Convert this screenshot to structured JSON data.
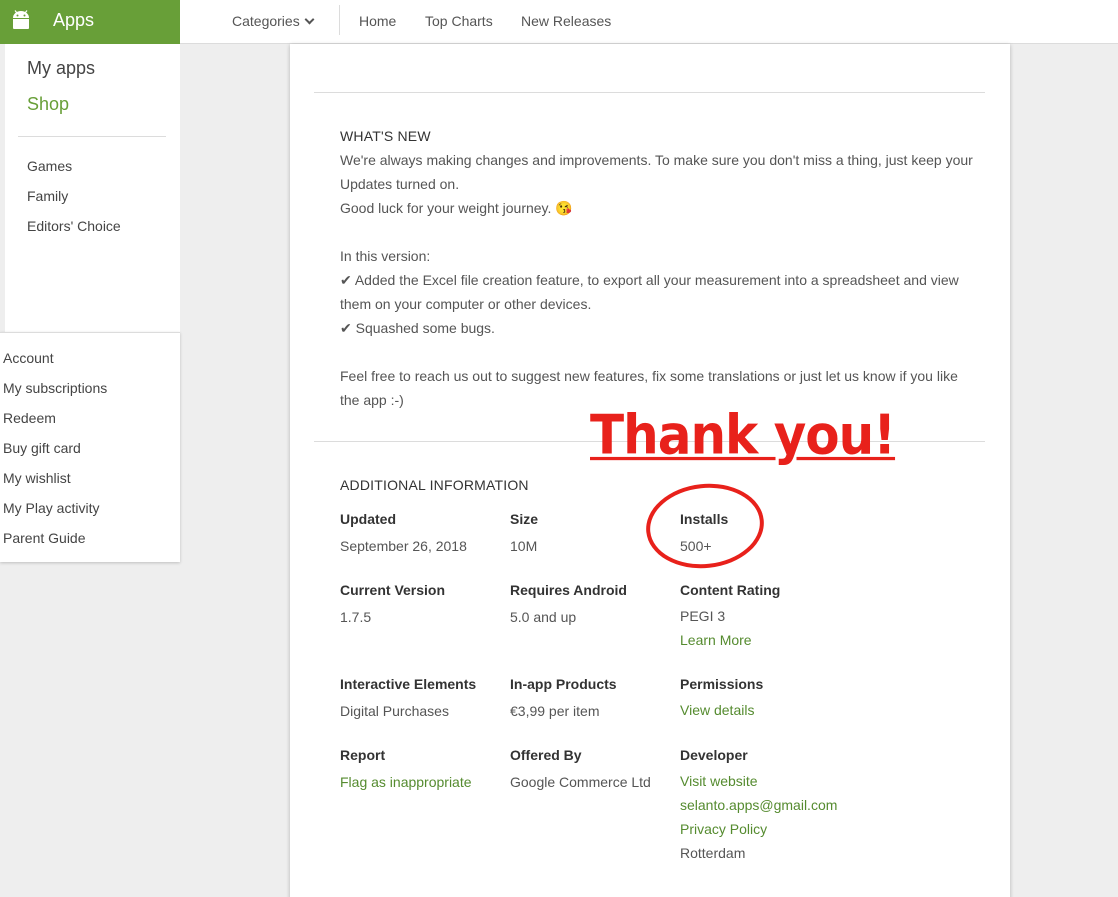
{
  "header": {
    "app_section": "Apps",
    "nav": {
      "categories": "Categories",
      "home": "Home",
      "top_charts": "Top Charts",
      "new_releases": "New Releases"
    }
  },
  "sidebar": {
    "my_apps": "My apps",
    "shop": "Shop",
    "items": [
      "Games",
      "Family",
      "Editors' Choice"
    ],
    "account_links": [
      "Account",
      "My subscriptions",
      "Redeem",
      "Buy gift card",
      "My wishlist",
      "My Play activity",
      "Parent Guide"
    ]
  },
  "whats_new": {
    "title": "WHAT'S NEW",
    "lines": [
      "We're always making changes and improvements. To make sure you don't miss a thing, just keep your",
      "Updates turned on.",
      "Good luck for your weight journey. 😘",
      "In this version:",
      "✔ Added the Excel file creation feature, to export all your measurement into a spreadsheet and view",
      "them on your computer or other devices.",
      "✔ Squashed some bugs.",
      "Feel free to reach us out to suggest new features, fix some translations or just let us know if you like",
      "the app :-)"
    ]
  },
  "additional_info": {
    "title": "ADDITIONAL INFORMATION",
    "updated": {
      "label": "Updated",
      "value": "September 26, 2018"
    },
    "size": {
      "label": "Size",
      "value": "10M"
    },
    "installs": {
      "label": "Installs",
      "value": "500+"
    },
    "current_version": {
      "label": "Current Version",
      "value": "1.7.5"
    },
    "requires_android": {
      "label": "Requires Android",
      "value": "5.0 and up"
    },
    "content_rating": {
      "label": "Content Rating",
      "value": "PEGI 3",
      "link": "Learn More"
    },
    "interactive_elements": {
      "label": "Interactive Elements",
      "value": "Digital Purchases"
    },
    "in_app_products": {
      "label": "In-app Products",
      "value": "€3,99 per item"
    },
    "permissions": {
      "label": "Permissions",
      "link": "View details"
    },
    "report": {
      "label": "Report",
      "link": "Flag as inappropriate"
    },
    "offered_by": {
      "label": "Offered By",
      "value": "Google Commerce Ltd"
    },
    "developer": {
      "label": "Developer",
      "website": "Visit website",
      "email": "selanto.apps@gmail.com",
      "privacy": "Privacy Policy",
      "city": "Rotterdam"
    }
  },
  "annotation": {
    "text": "Thank you!",
    "color": "#e8211b"
  },
  "colors": {
    "brand": "#689f38",
    "link": "#558b2f"
  }
}
